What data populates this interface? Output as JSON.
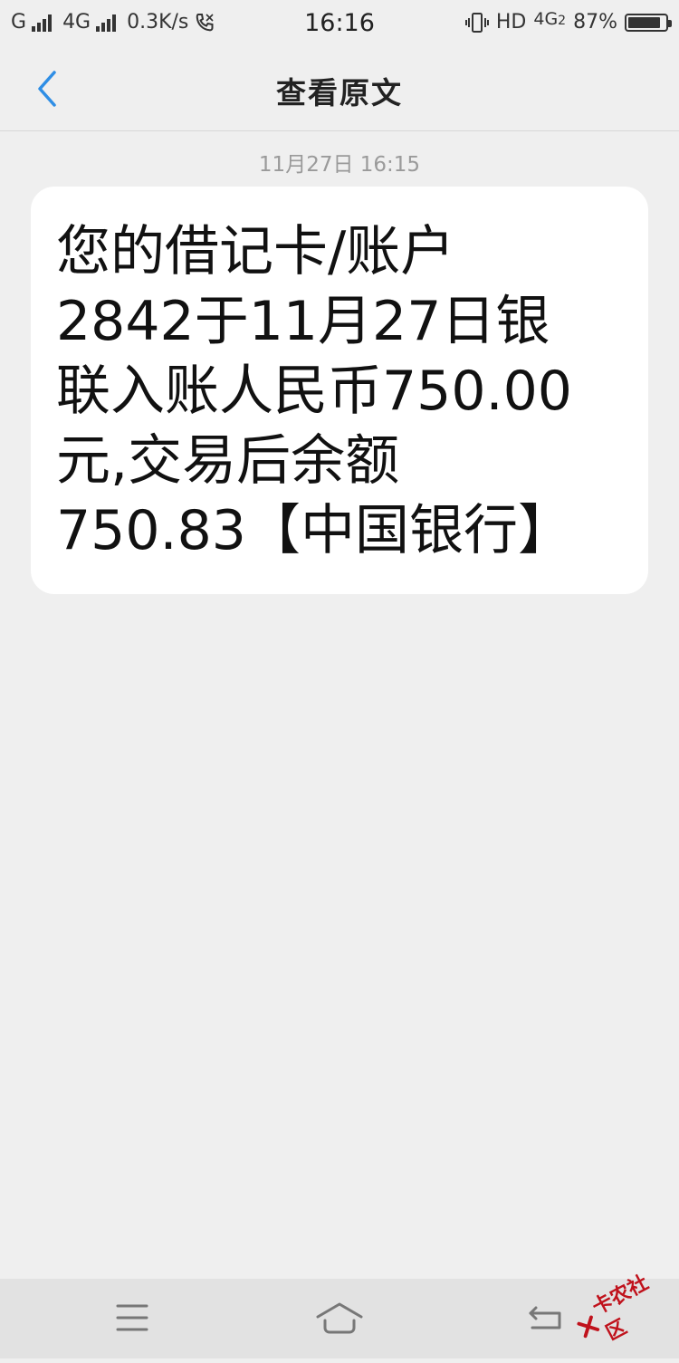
{
  "status_bar": {
    "sim1": "G",
    "sim2": "4G",
    "speed": "0.3K/s",
    "time": "16:16",
    "hd": "HD",
    "network_right": "4G",
    "network_right_sub": "2",
    "battery": "87%",
    "battery_level": 0.87
  },
  "nav": {
    "title": "查看原文",
    "back_icon": "chevron-left-icon"
  },
  "message": {
    "timestamp": "11月27日 16:15",
    "lines": [
      "您的借记卡/账户",
      "2842于11月27日银",
      "联入账人民币750.00",
      "元,交易后余额",
      "750.83【中国银行】"
    ]
  },
  "bottom_nav": {
    "menu_icon": "menu-icon",
    "home_icon": "home-icon",
    "back_icon": "return-icon"
  },
  "watermark": {
    "text": "卡农社区"
  },
  "colors": {
    "accent": "#2f8ee5",
    "background": "#efefef",
    "bubble": "#ffffff",
    "watermark": "#c0121c"
  }
}
